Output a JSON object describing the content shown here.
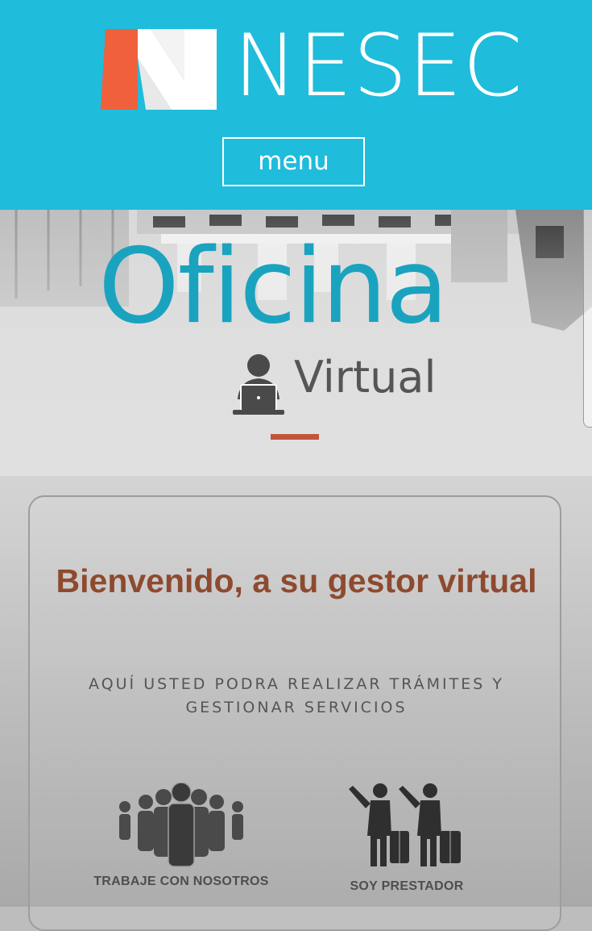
{
  "header": {
    "brand_name": "NESEC",
    "menu_label": "menu",
    "logo_icon": "nesec-logo-icon",
    "colors": {
      "background": "#1fbcdc",
      "logo_accent": "#f0603c",
      "text": "#ffffff"
    }
  },
  "hero": {
    "title_main": "Oficina",
    "title_sub": "Virtual",
    "icon": "worker-at-laptop-icon",
    "colors": {
      "title_main": "#1aa3bf",
      "title_sub": "#555555",
      "accent_line": "#c1553b"
    }
  },
  "welcome_card": {
    "title": "Bienvenido, a su gestor virtual",
    "subtitle": "AQUÍ USTED PODRA REALIZAR TRÁMITES Y GESTIONAR SERVICIOS",
    "title_color": "#8e4a2f",
    "options": [
      {
        "label": "TRABAJE CON NOSOTROS",
        "icon": "group-of-people-icon"
      },
      {
        "label": "SOY PRESTADOR",
        "icon": "hailing-travelers-icon"
      }
    ]
  }
}
